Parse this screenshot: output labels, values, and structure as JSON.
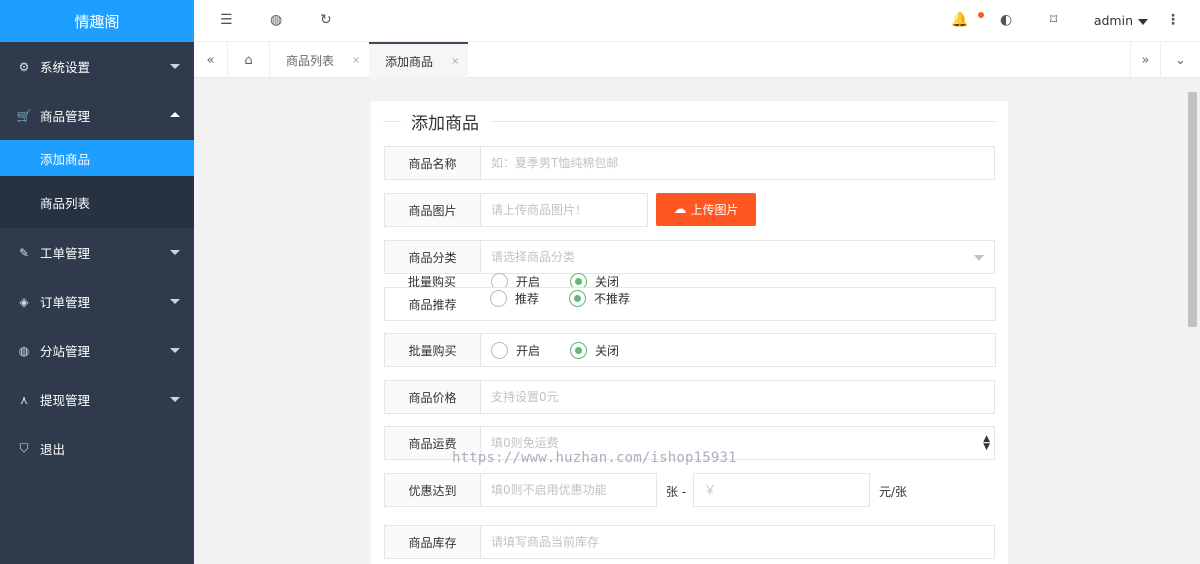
{
  "app": {
    "logo": "情趣阁"
  },
  "sidebar": {
    "items": [
      {
        "icon": "⚙",
        "label": "系统设置"
      },
      {
        "icon": "🛒",
        "label": "商品管理"
      },
      {
        "icon": "✎",
        "label": "工单管理"
      },
      {
        "icon": "◈",
        "label": "订单管理"
      },
      {
        "icon": "◍",
        "label": "分站管理"
      },
      {
        "icon": "⋏",
        "label": "提现管理"
      },
      {
        "icon": "⛉",
        "label": "退出"
      }
    ],
    "submenu": [
      {
        "label": "添加商品"
      },
      {
        "label": "商品列表"
      }
    ]
  },
  "header": {
    "user": "admin",
    "icons": [
      "menu-icon",
      "globe-icon",
      "refresh-icon",
      "bell-icon",
      "palette-icon",
      "tag-icon",
      "more-icon"
    ]
  },
  "tabs": {
    "home_icon": "⌂",
    "items": [
      {
        "label": "商品列表",
        "close": "×"
      },
      {
        "label": "添加商品",
        "close": "×"
      }
    ]
  },
  "form": {
    "title": "添加商品",
    "fields": {
      "name": {
        "label": "商品名称",
        "placeholder": "如：夏季男T恤纯棉包邮"
      },
      "image": {
        "label": "商品图片",
        "placeholder": "请上传商品图片！",
        "button": "上传图片"
      },
      "category": {
        "label": "商品分类",
        "placeholder": "请选择商品分类"
      },
      "recommend": {
        "label": "商品推荐",
        "options": [
          "推荐",
          "不推荐"
        ],
        "selected": "不推荐"
      },
      "batch": {
        "label": "批量购买",
        "options": [
          "开启",
          "关闭"
        ],
        "selected": "关闭"
      },
      "price": {
        "label": "商品价格",
        "placeholder": "支持设置0元"
      },
      "shipping": {
        "label": "商品运费",
        "placeholder": "填0则免运费"
      },
      "discount": {
        "label": "优惠达到",
        "placeholder": "填0则不启用优惠功能",
        "mid": "张 -",
        "currency_placeholder": "￥",
        "suffix": "元/张"
      },
      "stock": {
        "label": "商品库存",
        "placeholder": "请填写商品当前库存"
      }
    }
  },
  "watermark": "https://www.huzhan.com/ishop15931",
  "colors": {
    "accent": "#1e9fff",
    "sidebar": "#2f3b4c",
    "upload": "#ff5722",
    "radio": "#5fb878"
  }
}
